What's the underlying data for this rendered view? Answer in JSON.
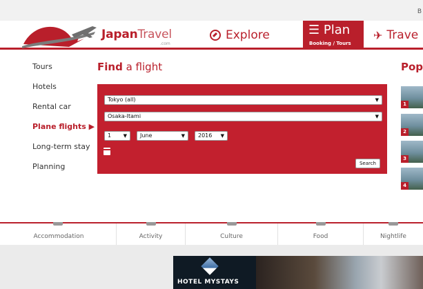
{
  "topbar": {
    "corner_text": "B"
  },
  "header": {
    "brand_bold": "Japan",
    "brand_light": "Travel",
    "brand_sub": ".com",
    "nav": {
      "explore": "Explore",
      "plan": "Plan",
      "plan_sub": "Booking / Tours",
      "travel": "Trave"
    }
  },
  "sidebar": {
    "items": [
      {
        "label": "Tours"
      },
      {
        "label": "Hotels"
      },
      {
        "label": "Rental car"
      },
      {
        "label": "Plane flights ▶",
        "active": true
      },
      {
        "label": "Long-term stay"
      },
      {
        "label": "Planning"
      }
    ]
  },
  "flight": {
    "title_bold": "Find",
    "title_rest": "a flight",
    "from": "Tokyo (all)",
    "to": "Osaka-Itami",
    "day": "1",
    "month": "June",
    "year": "2016",
    "search_label": "Search"
  },
  "popular": {
    "title": "Pop",
    "items": [
      {
        "num": "1"
      },
      {
        "num": "2"
      },
      {
        "num": "3"
      },
      {
        "num": "4"
      }
    ]
  },
  "categories": [
    {
      "label": "Accommodation"
    },
    {
      "label": "Activity"
    },
    {
      "label": "Culture"
    },
    {
      "label": "Food"
    },
    {
      "label": "Nightlife"
    }
  ],
  "ad": {
    "text": "HOTEL MYSTAYS"
  },
  "colors": {
    "brand_red": "#b91f2b",
    "panel_red": "#c2202e"
  },
  "icons": {
    "explore": "compass-icon",
    "plan": "list-icon",
    "travel": "plane-icon",
    "calendar": "calendar-icon"
  }
}
